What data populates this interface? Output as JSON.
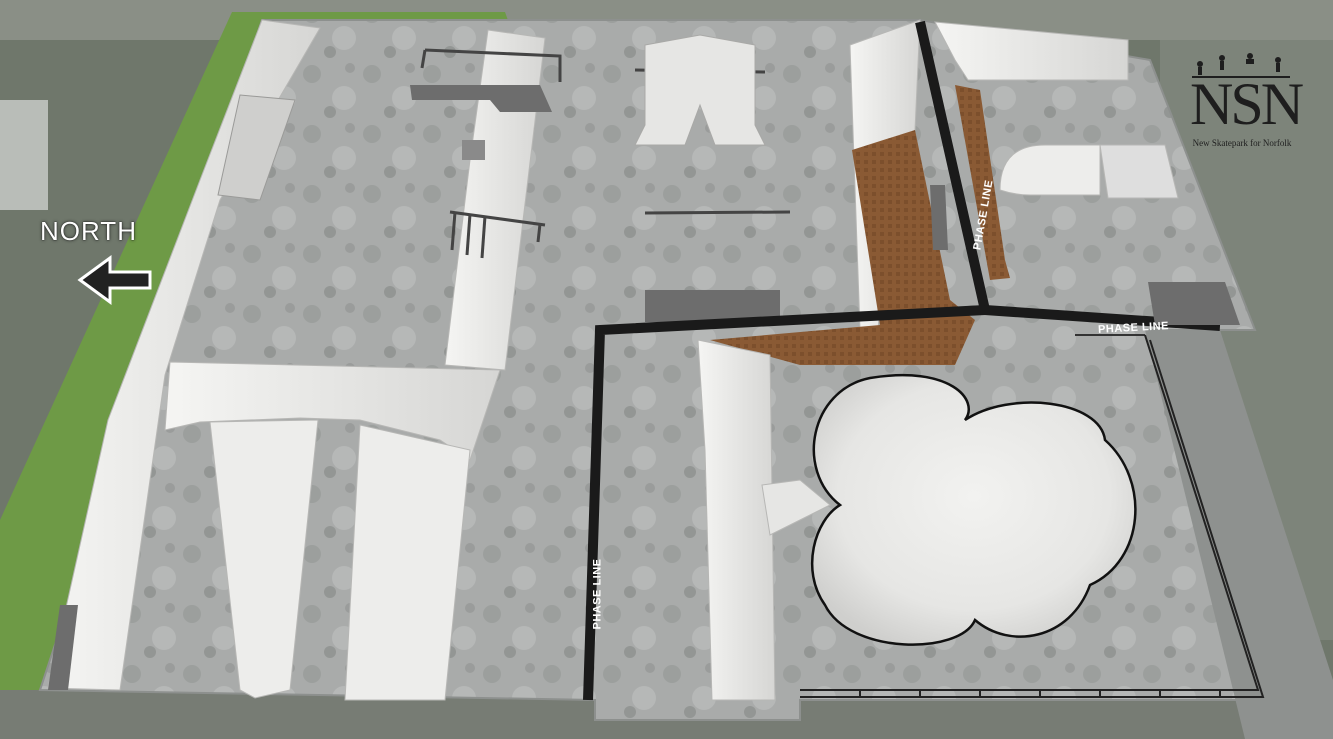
{
  "compass": {
    "label": "NORTH",
    "icon": "arrow-left-icon"
  },
  "phase_lines": [
    "PHASE LINE",
    "PHASE LINE",
    "PHASE LINE"
  ],
  "logo": {
    "mark": "NSN",
    "subtitle": "New Skatepark for Norfolk",
    "icon": "skater-silhouettes-icon"
  },
  "colors": {
    "grass": "#6e9a46",
    "concrete": "#a9abaa",
    "ramp": "#ececea",
    "brick": "#8a5a34",
    "phase_line": "#1a1a1a",
    "ledge": "#6d6d6d"
  }
}
